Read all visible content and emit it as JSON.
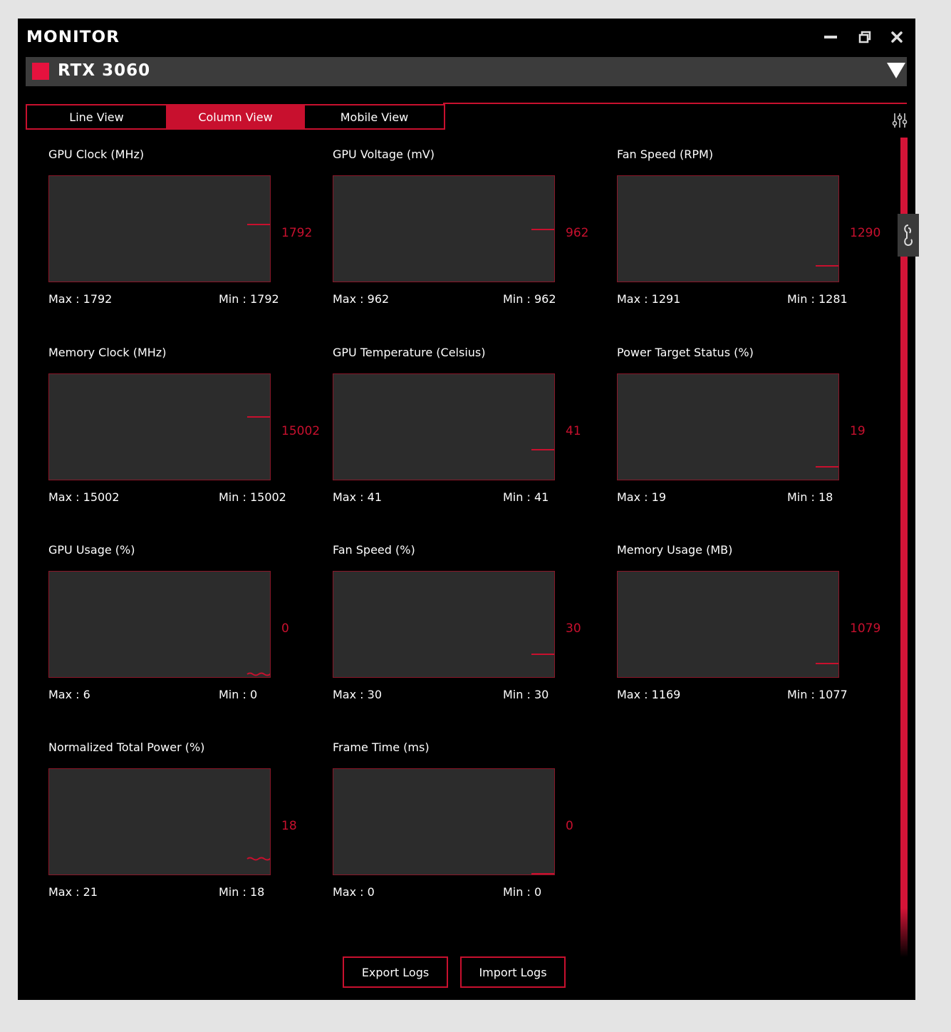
{
  "window": {
    "title": "MONITOR"
  },
  "device": {
    "name": "RTX 3060",
    "color": "#e6123e"
  },
  "tabs": [
    {
      "label": "Line View",
      "active": false
    },
    {
      "label": "Column View",
      "active": true
    },
    {
      "label": "Mobile View",
      "active": false
    }
  ],
  "panels": [
    {
      "title": "GPU Clock (MHz)",
      "current": "1792",
      "max": "Max : 1792",
      "min": "Min : 1792",
      "level": 0.55,
      "trace": "flat"
    },
    {
      "title": "GPU Voltage (mV)",
      "current": "962",
      "max": "Max : 962",
      "min": "Min : 962",
      "level": 0.5,
      "trace": "flat"
    },
    {
      "title": "Fan Speed (RPM)",
      "current": "1290",
      "max": "Max : 1291",
      "min": "Min : 1281",
      "level": 0.15,
      "trace": "flat"
    },
    {
      "title": "Memory Clock (MHz)",
      "current": "15002",
      "max": "Max : 15002",
      "min": "Min : 15002",
      "level": 0.6,
      "trace": "flat"
    },
    {
      "title": "GPU Temperature (Celsius)",
      "current": "41",
      "max": "Max : 41",
      "min": "Min : 41",
      "level": 0.29,
      "trace": "flat"
    },
    {
      "title": "Power Target Status (%)",
      "current": "19",
      "max": "Max : 19",
      "min": "Min : 18",
      "level": 0.12,
      "trace": "flat"
    },
    {
      "title": "GPU Usage (%)",
      "current": "0",
      "max": "Max : 6",
      "min": "Min : 0",
      "level": 0.03,
      "trace": "wavy"
    },
    {
      "title": "Fan Speed (%)",
      "current": "30",
      "max": "Max : 30",
      "min": "Min : 30",
      "level": 0.22,
      "trace": "flat"
    },
    {
      "title": "Memory Usage (MB)",
      "current": "1079",
      "max": "Max : 1169",
      "min": "Min : 1077",
      "level": 0.13,
      "trace": "flat"
    },
    {
      "title": "Normalized Total Power (%)",
      "current": "18",
      "max": "Max : 21",
      "min": "Min : 18",
      "level": 0.15,
      "trace": "wavy"
    },
    {
      "title": "Frame Time (ms)",
      "current": "0",
      "max": "Max : 0",
      "min": "Min : 0",
      "level": 0.01,
      "trace": "flat"
    }
  ],
  "buttons": {
    "export": "Export Logs",
    "import": "Import Logs"
  },
  "accent_color": "#c8102e",
  "icons": {
    "minimize": "minimize-icon",
    "restore": "restore-icon",
    "close": "close-icon",
    "settings": "sliders-icon",
    "side": "link-icon",
    "dropdown": "triangle-down-icon"
  }
}
